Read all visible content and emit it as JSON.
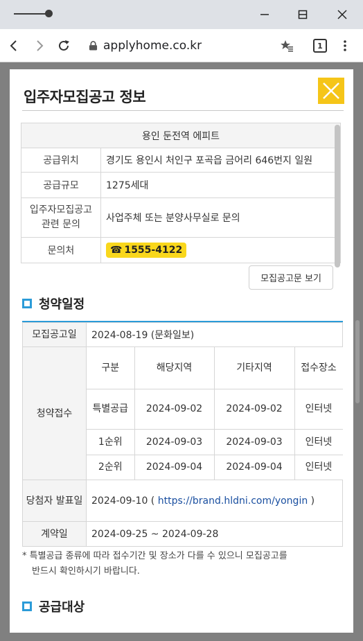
{
  "browser": {
    "url": "applyhome.co.kr",
    "tab_count": "1"
  },
  "modal": {
    "title": "입주자모집공고 정보",
    "info": {
      "complex_name": "용인 둔전역 에피트",
      "rows": [
        {
          "label": "공급위치",
          "value": "경기도 용인시 처인구 포곡읍 금어리 646번지 일원"
        },
        {
          "label": "공급규모",
          "value": "1275세대"
        },
        {
          "label_line1": "입주자모집공고",
          "label_line2": "관련 문의",
          "value": "사업주체 또는 분양사무실로 문의"
        },
        {
          "label": "문의처",
          "phone_icon": "☎",
          "value": "1555-4122"
        }
      ]
    },
    "notice_button": "모집공고문 보기",
    "schedule": {
      "heading": "청약일정",
      "announce_label": "모집공고일",
      "announce_value": "2024-08-19 (문화일보)",
      "apply_label": "청약접수",
      "columns": [
        "구분",
        "해당지역",
        "기타지역",
        "접수장소"
      ],
      "rows": [
        {
          "type": "특별공급",
          "local": "2024-09-02",
          "other": "2024-09-02",
          "place": "인터넷"
        },
        {
          "type": "1순위",
          "local": "2024-09-03",
          "other": "2024-09-03",
          "place": "인터넷"
        },
        {
          "type": "2순위",
          "local": "2024-09-04",
          "other": "2024-09-04",
          "place": "인터넷"
        }
      ],
      "winner_label": "당첨자 발표일",
      "winner_date": "2024-09-10 (",
      "winner_link": "https://brand.hldni.com/yongin",
      "winner_close": ")",
      "contract_label": "계약일",
      "contract_value": "2024-09-25 ~ 2024-09-28"
    },
    "footnote_line1": "* 특별공급 종류에 따라 접수기간 및 장소가 다를 수 있으니 모집공고를",
    "footnote_line2": "반드시 확인하시기 바랍니다.",
    "supply_heading": "공급대상"
  },
  "colors": {
    "accent": "#2b9bd8",
    "close_button": "#f5c518",
    "phone_badge": "#f9d71c",
    "link": "#1a4fa0"
  }
}
